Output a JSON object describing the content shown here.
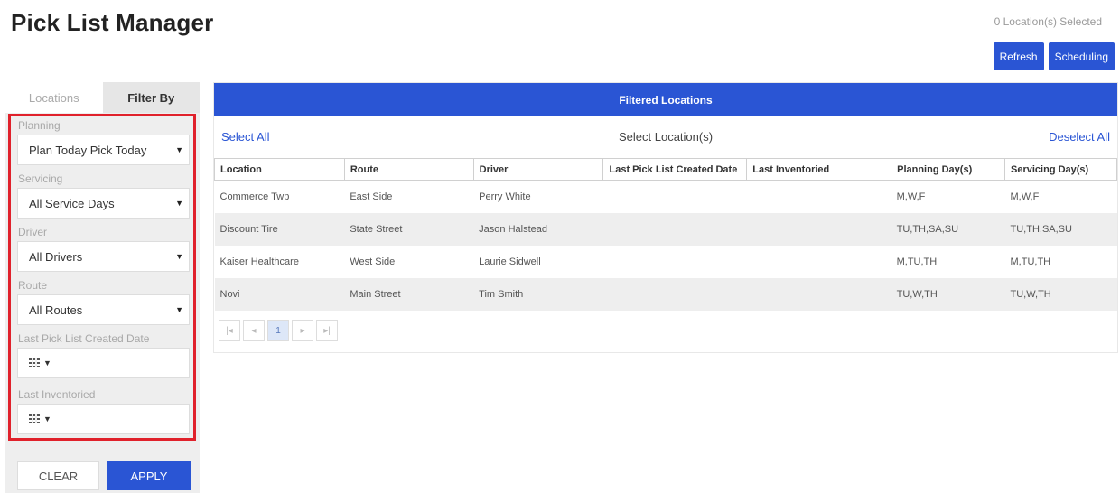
{
  "header": {
    "title": "Pick List Manager",
    "selected_count": "0 Location(s) Selected",
    "refresh_label": "Refresh",
    "scheduling_label": "Scheduling"
  },
  "sidebar": {
    "tabs": [
      {
        "label": "Locations",
        "active": false
      },
      {
        "label": "Filter By",
        "active": true
      }
    ],
    "filters": {
      "planning": {
        "label": "Planning",
        "value": "Plan Today Pick Today"
      },
      "servicing": {
        "label": "Servicing",
        "value": "All Service Days"
      },
      "driver": {
        "label": "Driver",
        "value": "All Drivers"
      },
      "route": {
        "label": "Route",
        "value": "All Routes"
      },
      "last_pick": {
        "label": "Last Pick List Created Date"
      },
      "last_inventoried": {
        "label": "Last Inventoried"
      }
    },
    "clear_label": "CLEAR",
    "apply_label": "APPLY"
  },
  "main": {
    "panel_title": "Filtered Locations",
    "select_all": "Select All",
    "select_locations": "Select Location(s)",
    "deselect_all": "Deselect All",
    "columns": [
      "Location",
      "Route",
      "Driver",
      "Last Pick List Created Date",
      "Last Inventoried",
      "Planning Day(s)",
      "Servicing Day(s)"
    ],
    "rows": [
      [
        "Commerce Twp",
        "East Side",
        "Perry White",
        "",
        "",
        "M,W,F",
        "M,W,F"
      ],
      [
        "Discount Tire",
        "State Street",
        "Jason Halstead",
        "",
        "",
        "TU,TH,SA,SU",
        "TU,TH,SA,SU"
      ],
      [
        "Kaiser Healthcare",
        "West Side",
        "Laurie Sidwell",
        "",
        "",
        "M,TU,TH",
        "M,TU,TH"
      ],
      [
        "Novi",
        "Main Street",
        "Tim Smith",
        "",
        "",
        "TU,W,TH",
        "TU,W,TH"
      ]
    ],
    "pager": {
      "first": "|◂",
      "prev": "◂",
      "current_page": "1",
      "next": "▸",
      "last": "▸|"
    }
  },
  "colors": {
    "accent": "#2a55d4",
    "highlight_border": "#e0212b"
  },
  "icons": {
    "calendar": "calendar-icon",
    "dropdown": "caret-down-icon"
  }
}
